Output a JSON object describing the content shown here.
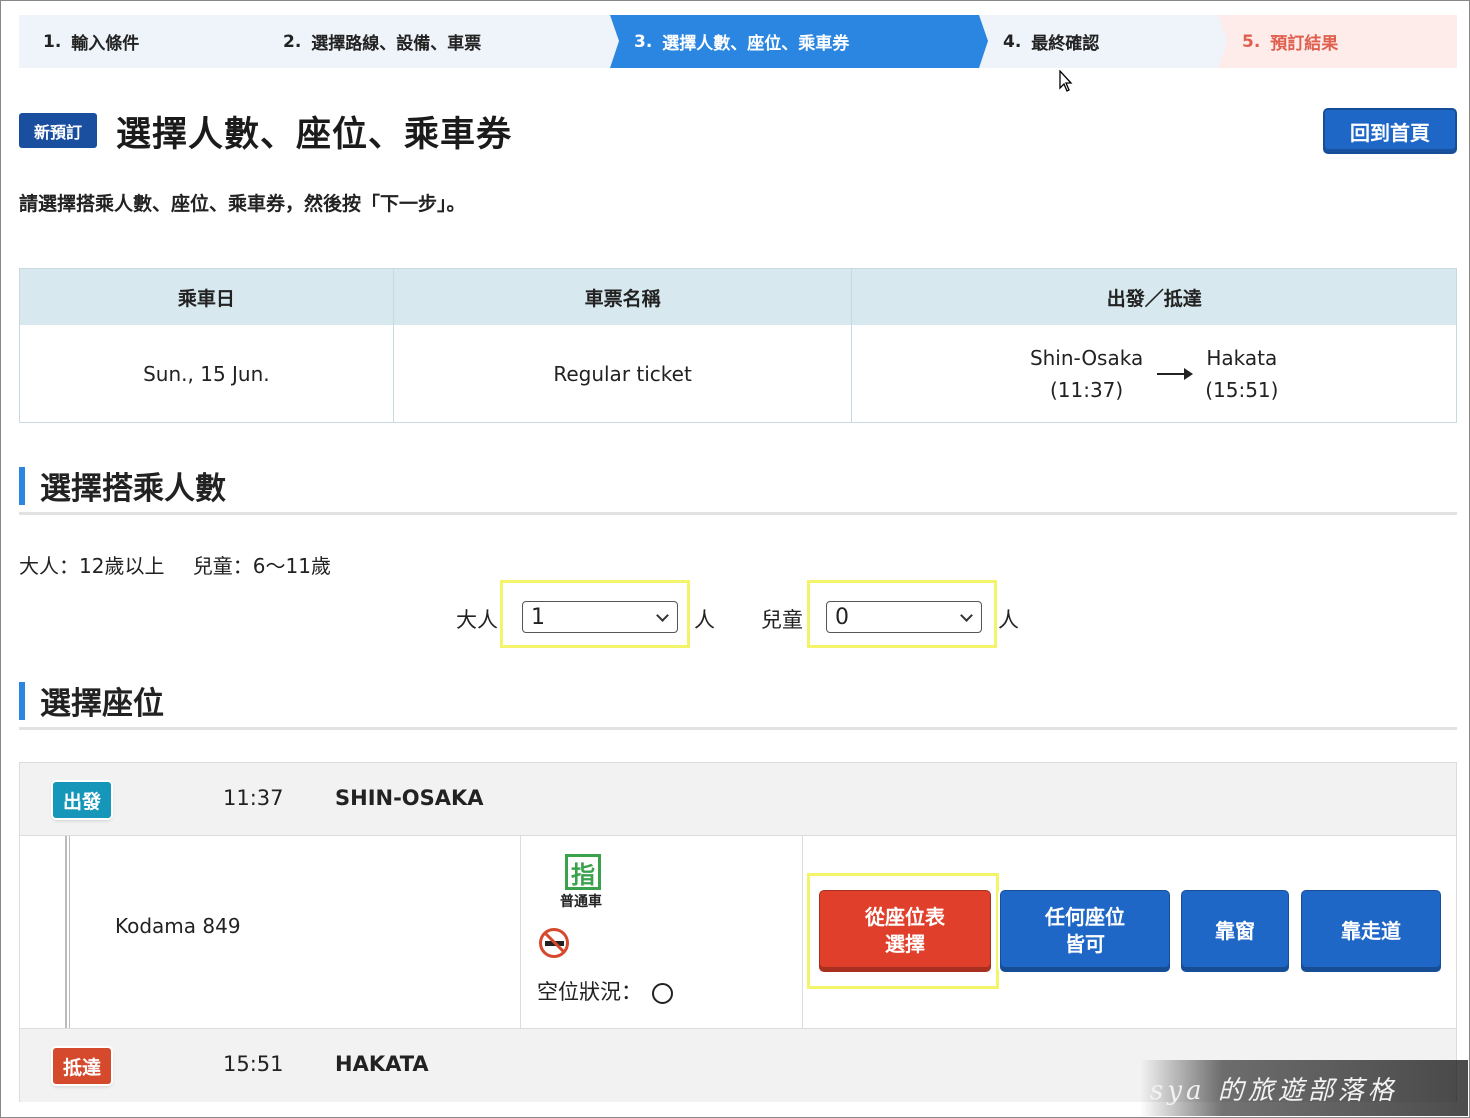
{
  "steps": [
    {
      "num": "1.",
      "label": "輸入條件"
    },
    {
      "num": "2.",
      "label": "選擇路線、設備、車票"
    },
    {
      "num": "3.",
      "label": "選擇人數、座位、乘車券"
    },
    {
      "num": "4.",
      "label": "最終確認"
    },
    {
      "num": "5.",
      "label": "預訂結果"
    }
  ],
  "header": {
    "badge": "新預訂",
    "title": "選擇人數、座位、乘車券",
    "home_button": "回到首頁",
    "instruction": "請選擇搭乘人數、座位、乘車券，然後按「下一步」。"
  },
  "summary": {
    "headers": [
      "乘車日",
      "車票名稱",
      "出發／抵達"
    ],
    "date": "Sun., 15 Jun.",
    "ticket": "Regular ticket",
    "from_station": "Shin-Osaka",
    "from_time": "(11:37)",
    "to_station": "Hakata",
    "to_time": "(15:51)"
  },
  "passengers": {
    "section_title": "選擇搭乘人數",
    "adult_note": "大人：12歲以上",
    "child_note": "兒童：6〜11歲",
    "adult_label": "大人",
    "adult_value": "1",
    "child_label": "兒童",
    "child_value": "0",
    "unit": "人"
  },
  "seat": {
    "section_title": "選擇座位",
    "departure_tag": "出發",
    "departure_time": "11:37",
    "departure_station": "SHIN-OSAKA",
    "train": "Kodama 849",
    "reserved_icon": "指",
    "car_type": "普通車",
    "availability_label": "空位狀況：",
    "buttons": {
      "seat_map": [
        "從座位表",
        "選擇"
      ],
      "any_seat": [
        "任何座位",
        "皆可"
      ],
      "window": "靠窗",
      "aisle": "靠走道"
    },
    "arrival_tag": "抵達",
    "arrival_time": "15:51",
    "arrival_station": "HAKATA"
  },
  "watermark": "sya 的旅遊部落格",
  "colors": {
    "active_step": "#2a86e0",
    "brand_blue": "#1f67c6",
    "red_button": "#e0402b",
    "highlight": "#f4f46a"
  }
}
